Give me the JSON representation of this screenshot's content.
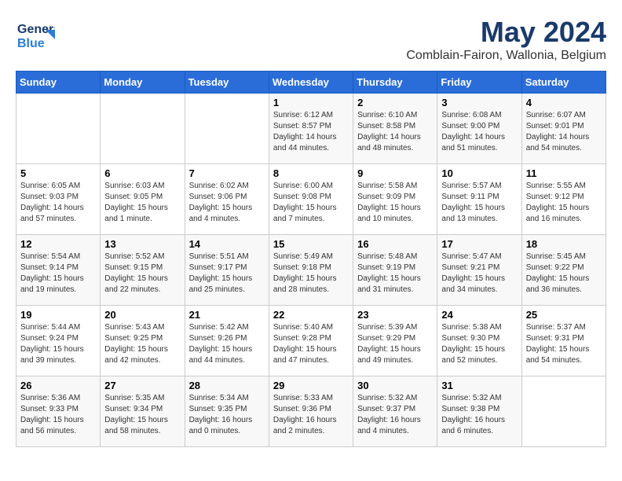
{
  "header": {
    "logo_line1": "General",
    "logo_line2": "Blue",
    "month": "May 2024",
    "location": "Comblain-Fairon, Wallonia, Belgium"
  },
  "days_of_week": [
    "Sunday",
    "Monday",
    "Tuesday",
    "Wednesday",
    "Thursday",
    "Friday",
    "Saturday"
  ],
  "weeks": [
    [
      {
        "day": "",
        "info": ""
      },
      {
        "day": "",
        "info": ""
      },
      {
        "day": "",
        "info": ""
      },
      {
        "day": "1",
        "info": "Sunrise: 6:12 AM\nSunset: 8:57 PM\nDaylight: 14 hours\nand 44 minutes."
      },
      {
        "day": "2",
        "info": "Sunrise: 6:10 AM\nSunset: 8:58 PM\nDaylight: 14 hours\nand 48 minutes."
      },
      {
        "day": "3",
        "info": "Sunrise: 6:08 AM\nSunset: 9:00 PM\nDaylight: 14 hours\nand 51 minutes."
      },
      {
        "day": "4",
        "info": "Sunrise: 6:07 AM\nSunset: 9:01 PM\nDaylight: 14 hours\nand 54 minutes."
      }
    ],
    [
      {
        "day": "5",
        "info": "Sunrise: 6:05 AM\nSunset: 9:03 PM\nDaylight: 14 hours\nand 57 minutes."
      },
      {
        "day": "6",
        "info": "Sunrise: 6:03 AM\nSunset: 9:05 PM\nDaylight: 15 hours\nand 1 minute."
      },
      {
        "day": "7",
        "info": "Sunrise: 6:02 AM\nSunset: 9:06 PM\nDaylight: 15 hours\nand 4 minutes."
      },
      {
        "day": "8",
        "info": "Sunrise: 6:00 AM\nSunset: 9:08 PM\nDaylight: 15 hours\nand 7 minutes."
      },
      {
        "day": "9",
        "info": "Sunrise: 5:58 AM\nSunset: 9:09 PM\nDaylight: 15 hours\nand 10 minutes."
      },
      {
        "day": "10",
        "info": "Sunrise: 5:57 AM\nSunset: 9:11 PM\nDaylight: 15 hours\nand 13 minutes."
      },
      {
        "day": "11",
        "info": "Sunrise: 5:55 AM\nSunset: 9:12 PM\nDaylight: 15 hours\nand 16 minutes."
      }
    ],
    [
      {
        "day": "12",
        "info": "Sunrise: 5:54 AM\nSunset: 9:14 PM\nDaylight: 15 hours\nand 19 minutes."
      },
      {
        "day": "13",
        "info": "Sunrise: 5:52 AM\nSunset: 9:15 PM\nDaylight: 15 hours\nand 22 minutes."
      },
      {
        "day": "14",
        "info": "Sunrise: 5:51 AM\nSunset: 9:17 PM\nDaylight: 15 hours\nand 25 minutes."
      },
      {
        "day": "15",
        "info": "Sunrise: 5:49 AM\nSunset: 9:18 PM\nDaylight: 15 hours\nand 28 minutes."
      },
      {
        "day": "16",
        "info": "Sunrise: 5:48 AM\nSunset: 9:19 PM\nDaylight: 15 hours\nand 31 minutes."
      },
      {
        "day": "17",
        "info": "Sunrise: 5:47 AM\nSunset: 9:21 PM\nDaylight: 15 hours\nand 34 minutes."
      },
      {
        "day": "18",
        "info": "Sunrise: 5:45 AM\nSunset: 9:22 PM\nDaylight: 15 hours\nand 36 minutes."
      }
    ],
    [
      {
        "day": "19",
        "info": "Sunrise: 5:44 AM\nSunset: 9:24 PM\nDaylight: 15 hours\nand 39 minutes."
      },
      {
        "day": "20",
        "info": "Sunrise: 5:43 AM\nSunset: 9:25 PM\nDaylight: 15 hours\nand 42 minutes."
      },
      {
        "day": "21",
        "info": "Sunrise: 5:42 AM\nSunset: 9:26 PM\nDaylight: 15 hours\nand 44 minutes."
      },
      {
        "day": "22",
        "info": "Sunrise: 5:40 AM\nSunset: 9:28 PM\nDaylight: 15 hours\nand 47 minutes."
      },
      {
        "day": "23",
        "info": "Sunrise: 5:39 AM\nSunset: 9:29 PM\nDaylight: 15 hours\nand 49 minutes."
      },
      {
        "day": "24",
        "info": "Sunrise: 5:38 AM\nSunset: 9:30 PM\nDaylight: 15 hours\nand 52 minutes."
      },
      {
        "day": "25",
        "info": "Sunrise: 5:37 AM\nSunset: 9:31 PM\nDaylight: 15 hours\nand 54 minutes."
      }
    ],
    [
      {
        "day": "26",
        "info": "Sunrise: 5:36 AM\nSunset: 9:33 PM\nDaylight: 15 hours\nand 56 minutes."
      },
      {
        "day": "27",
        "info": "Sunrise: 5:35 AM\nSunset: 9:34 PM\nDaylight: 15 hours\nand 58 minutes."
      },
      {
        "day": "28",
        "info": "Sunrise: 5:34 AM\nSunset: 9:35 PM\nDaylight: 16 hours\nand 0 minutes."
      },
      {
        "day": "29",
        "info": "Sunrise: 5:33 AM\nSunset: 9:36 PM\nDaylight: 16 hours\nand 2 minutes."
      },
      {
        "day": "30",
        "info": "Sunrise: 5:32 AM\nSunset: 9:37 PM\nDaylight: 16 hours\nand 4 minutes."
      },
      {
        "day": "31",
        "info": "Sunrise: 5:32 AM\nSunset: 9:38 PM\nDaylight: 16 hours\nand 6 minutes."
      },
      {
        "day": "",
        "info": ""
      }
    ]
  ]
}
